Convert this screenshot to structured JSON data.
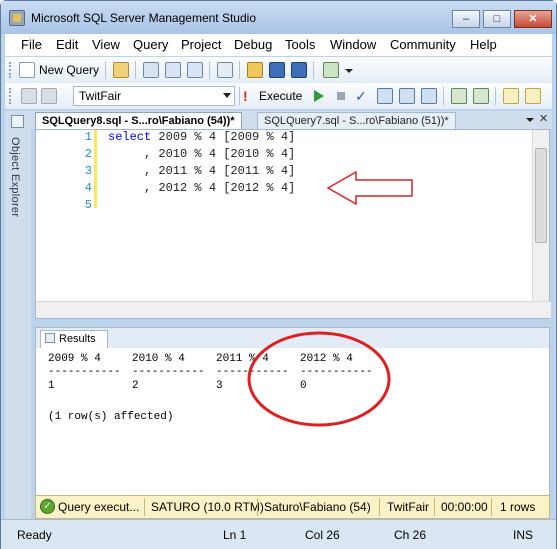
{
  "window": {
    "title": "Microsoft SQL Server Management Studio",
    "controls": {
      "minimize": "–",
      "maximize": "□",
      "close": "✕"
    }
  },
  "menu": [
    "File",
    "Edit",
    "View",
    "Query",
    "Project",
    "Debug",
    "Tools",
    "Window",
    "Community",
    "Help"
  ],
  "toolbar1": {
    "new_query": "New Query"
  },
  "toolbar2": {
    "database": "TwitFair",
    "execute": "Execute"
  },
  "sidebar": {
    "object_explorer": "Object Explorer"
  },
  "tabs": [
    {
      "label": "SQLQuery8.sql - S...ro\\Fabiano (54))*",
      "active": true
    },
    {
      "label": "SQLQuery7.sql - S...ro\\Fabiano (51))*",
      "active": false
    }
  ],
  "editor": {
    "line_numbers": [
      "1",
      "2",
      "3",
      "4",
      "5"
    ],
    "lines": [
      {
        "keyword": "select",
        "rest": " 2009 % 4 [2009 % 4]"
      },
      {
        "keyword": "",
        "rest": "     , 2010 % 4 [2010 % 4]"
      },
      {
        "keyword": "",
        "rest": "     , 2011 % 4 [2011 % 4]"
      },
      {
        "keyword": "",
        "rest": "     , 2012 % 4 [2012 % 4]"
      },
      {
        "keyword": "",
        "rest": ""
      }
    ]
  },
  "results": {
    "tab_label": "Results",
    "columns": [
      {
        "header": "2009 % 4",
        "dashes": "-----------",
        "value": "1"
      },
      {
        "header": "2010 % 4",
        "dashes": "-----------",
        "value": "2"
      },
      {
        "header": "2011 % 4",
        "dashes": "-----------",
        "value": "3"
      },
      {
        "header": "2012 % 4",
        "dashes": "-----------",
        "value": "0"
      }
    ],
    "message": "(1 row(s) affected)"
  },
  "query_status": {
    "state": "Query execut...",
    "server": "SATURO (10.0 RTM)",
    "user": "Saturo\\Fabiano (54)",
    "database": "TwitFair",
    "elapsed": "00:00:00",
    "rows": "1 rows"
  },
  "status_bar": {
    "state": "Ready",
    "ln": "Ln 1",
    "col": "Col 26",
    "ch": "Ch 26",
    "mode": "INS"
  },
  "colors": {
    "keyword": "#0000ff",
    "line_number": "#2b91af",
    "annotation": "#e02020"
  }
}
